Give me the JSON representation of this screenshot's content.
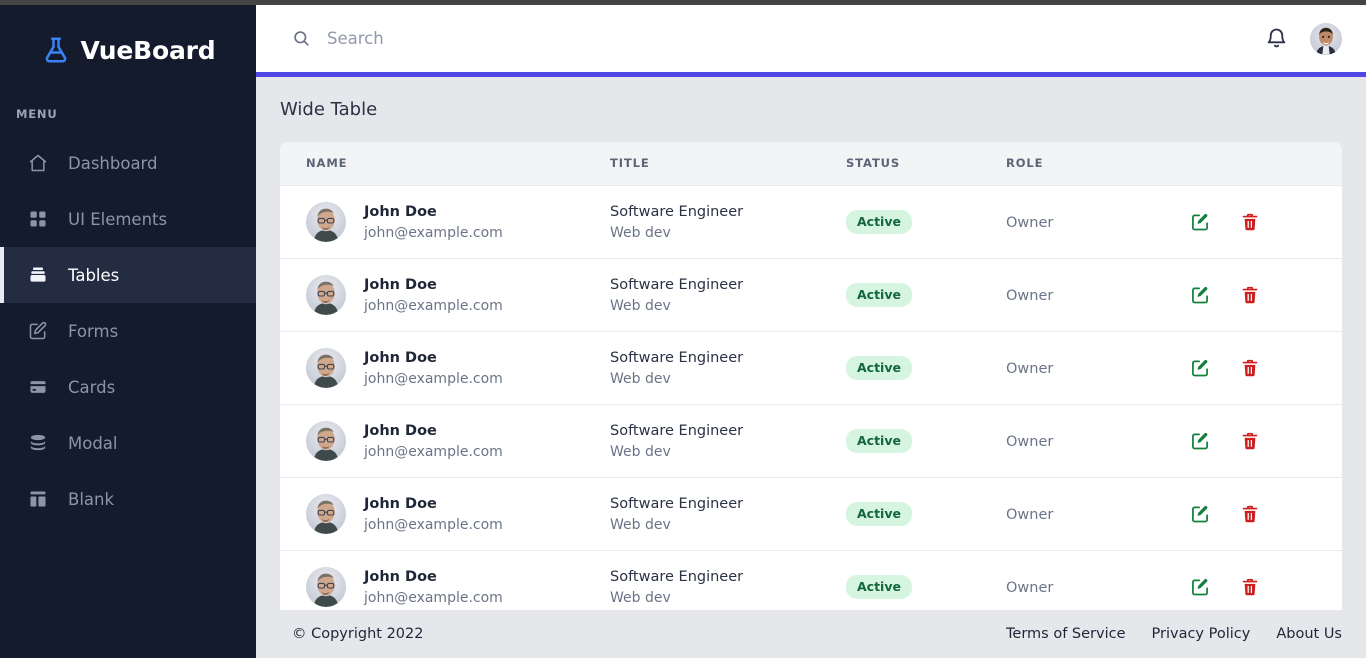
{
  "brand": {
    "name": "VueBoard",
    "icon": "flask-icon"
  },
  "sidebar": {
    "menu_label": "MENU",
    "items": [
      {
        "label": "Dashboard",
        "icon": "home-icon",
        "active": false
      },
      {
        "label": "UI Elements",
        "icon": "grid-icon",
        "active": false
      },
      {
        "label": "Tables",
        "icon": "table-icon",
        "active": true
      },
      {
        "label": "Forms",
        "icon": "edit-square-icon",
        "active": false
      },
      {
        "label": "Cards",
        "icon": "card-icon",
        "active": false
      },
      {
        "label": "Modal",
        "icon": "layers-icon",
        "active": false
      },
      {
        "label": "Blank",
        "icon": "layout-icon",
        "active": false
      }
    ]
  },
  "header": {
    "search_placeholder": "Search",
    "search_value": "",
    "search_icon": "search-icon",
    "bell_icon": "bell-icon",
    "avatar": "user-avatar"
  },
  "main": {
    "page_title": "Wide Table",
    "columns": [
      "NAME",
      "TITLE",
      "STATUS",
      "ROLE",
      ""
    ],
    "rows": [
      {
        "name": "John Doe",
        "email": "john@example.com",
        "title": "Software Engineer",
        "dept": "Web dev",
        "status": "Active",
        "role": "Owner"
      },
      {
        "name": "John Doe",
        "email": "john@example.com",
        "title": "Software Engineer",
        "dept": "Web dev",
        "status": "Active",
        "role": "Owner"
      },
      {
        "name": "John Doe",
        "email": "john@example.com",
        "title": "Software Engineer",
        "dept": "Web dev",
        "status": "Active",
        "role": "Owner"
      },
      {
        "name": "John Doe",
        "email": "john@example.com",
        "title": "Software Engineer",
        "dept": "Web dev",
        "status": "Active",
        "role": "Owner"
      },
      {
        "name": "John Doe",
        "email": "john@example.com",
        "title": "Software Engineer",
        "dept": "Web dev",
        "status": "Active",
        "role": "Owner"
      },
      {
        "name": "John Doe",
        "email": "john@example.com",
        "title": "Software Engineer",
        "dept": "Web dev",
        "status": "Active",
        "role": "Owner"
      }
    ],
    "edit_icon": "edit-icon",
    "delete_icon": "trash-icon"
  },
  "footer": {
    "copyright": "© Copyright 2022",
    "links": [
      "Terms of Service",
      "Privacy Policy",
      "About Us"
    ]
  },
  "colors": {
    "sidebar_bg": "#141b2d",
    "accent": "#4f46e5",
    "badge_bg": "#d5f5e0",
    "badge_text": "#14663b",
    "edit_green": "#15803d",
    "delete_red": "#cc1f1f"
  }
}
